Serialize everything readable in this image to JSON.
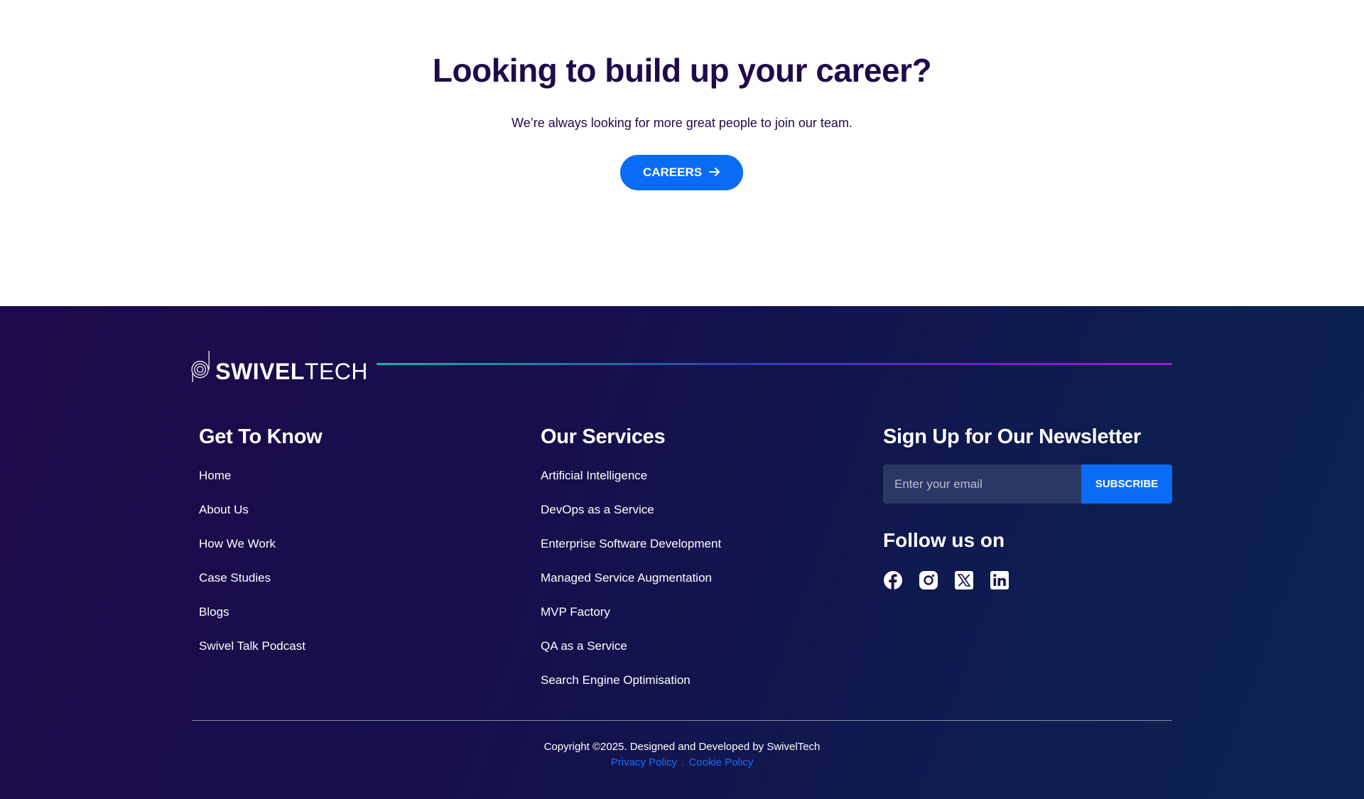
{
  "careers": {
    "title": "Looking to build up your career?",
    "subtitle": "We’re always looking for more great people to join our team.",
    "button_label": "CAREERS",
    "button_icon": "arrow-right-icon"
  },
  "footer": {
    "logo": {
      "bold": "SWIVEL",
      "light": "TECH"
    },
    "get_to_know": {
      "heading": "Get To Know",
      "links": [
        "Home",
        "About Us",
        "How We Work",
        "Case Studies",
        "Blogs",
        "Swivel Talk Podcast"
      ]
    },
    "services": {
      "heading": "Our Services",
      "links": [
        "Artificial Intelligence",
        "DevOps as a Service",
        "Enterprise Software Development",
        "Managed Service Augmentation",
        "MVP Factory",
        "QA as a Service",
        "Search Engine Optimisation"
      ]
    },
    "newsletter": {
      "heading": "Sign Up for Our Newsletter",
      "placeholder": "Enter your email",
      "button_label": "SUBSCRIBE"
    },
    "follow": {
      "heading": "Follow us on",
      "icons": [
        "facebook-icon",
        "instagram-icon",
        "x-icon",
        "linkedin-icon"
      ]
    },
    "copyright": "Copyright ©2025. Designed and Developed by SwivelTech",
    "privacy_label": "Privacy Policy",
    "separator": ".",
    "cookie_label": "Cookie Policy"
  },
  "colors": {
    "accent": "#0a6cf5",
    "heading_dark": "#1f0a4a",
    "footer_bg_start": "#1e0a4a",
    "footer_bg_end": "#0b2451",
    "link_blue": "#1f6ff0"
  }
}
